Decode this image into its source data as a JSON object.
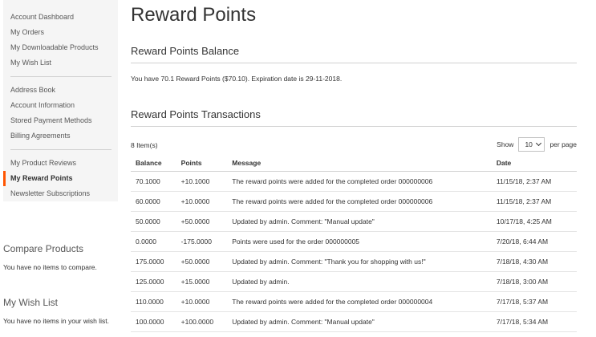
{
  "sidebar": {
    "groups": [
      [
        {
          "label": "Account Dashboard",
          "active": false
        },
        {
          "label": "My Orders",
          "active": false
        },
        {
          "label": "My Downloadable Products",
          "active": false
        },
        {
          "label": "My Wish List",
          "active": false
        }
      ],
      [
        {
          "label": "Address Book",
          "active": false
        },
        {
          "label": "Account Information",
          "active": false
        },
        {
          "label": "Stored Payment Methods",
          "active": false
        },
        {
          "label": "Billing Agreements",
          "active": false
        }
      ],
      [
        {
          "label": "My Product Reviews",
          "active": false
        },
        {
          "label": "My Reward Points",
          "active": true
        },
        {
          "label": "Newsletter Subscriptions",
          "active": false
        }
      ]
    ],
    "accent_color": "#ff5501"
  },
  "compare_block": {
    "title": "Compare Products",
    "text": "You have no items to compare."
  },
  "wishlist_block": {
    "title": "My Wish List",
    "text": "You have no items in your wish list."
  },
  "main": {
    "page_title": "Reward Points",
    "balance_section_title": "Reward Points Balance",
    "balance_text": "You have 70.1 Reward Points ($70.10). Expiration date is 29-11-2018.",
    "transactions_section_title": "Reward Points Transactions",
    "item_count": "8 Item(s)",
    "limiter": {
      "show_label": "Show",
      "value": "10",
      "per_page_label": "per page"
    },
    "table": {
      "headers": [
        "Balance",
        "Points",
        "Message",
        "Date"
      ],
      "rows": [
        [
          "70.1000",
          "+10.1000",
          "The reward points were added for the completed order 000000006",
          "11/15/18, 2:37 AM"
        ],
        [
          "60.0000",
          "+10.0000",
          "The reward points were added for the completed order 000000006",
          "11/15/18, 2:37 AM"
        ],
        [
          "50.0000",
          "+50.0000",
          "Updated by admin. Comment: \"Manual update\"",
          "10/17/18, 4:25 AM"
        ],
        [
          "0.0000",
          "-175.0000",
          "Points were used for the order 000000005",
          "7/20/18, 6:44 AM"
        ],
        [
          "175.0000",
          "+50.0000",
          "Updated by admin. Comment: \"Thank you for shopping with us!\"",
          "7/18/18, 4:30 AM"
        ],
        [
          "125.0000",
          "+15.0000",
          "Updated by admin.",
          "7/18/18, 3:00 AM"
        ],
        [
          "110.0000",
          "+10.0000",
          "The reward points were added for the completed order 000000004",
          "7/17/18, 5:37 AM"
        ],
        [
          "100.0000",
          "+100.0000",
          "Updated by admin. Comment: \"Manual update\"",
          "7/17/18, 5:34 AM"
        ]
      ]
    }
  }
}
